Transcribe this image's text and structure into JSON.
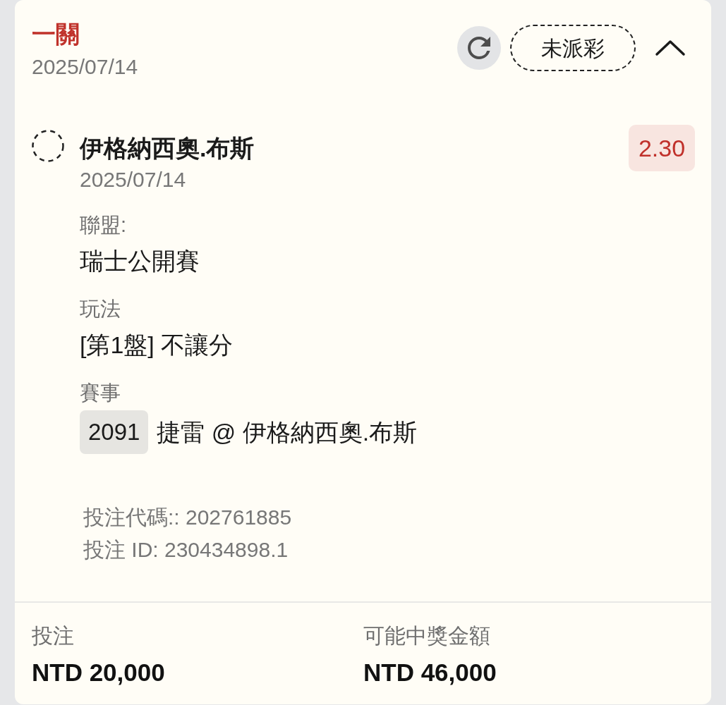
{
  "header": {
    "title": "一關",
    "date": "2025/07/14",
    "status": "未派彩",
    "expanded": true
  },
  "selection": {
    "name": "伊格納西奧.布斯",
    "date": "2025/07/14",
    "odds": "2.30"
  },
  "details": [
    {
      "kind": "text",
      "label": "聯盟:",
      "value": "瑞士公開賽"
    },
    {
      "kind": "text",
      "label": "玩法",
      "value": "[第1盤] 不讓分"
    },
    {
      "kind": "match",
      "label": "賽事",
      "code": "2091",
      "value": "捷雷 @ 伊格納西奧.布斯"
    }
  ],
  "references": [
    "投注代碼:: 202761885",
    "投注 ID: 230434898.1"
  ],
  "summary": [
    {
      "label": "投注",
      "value": "NTD 20,000"
    },
    {
      "label": "可能中獎金額",
      "value": "NTD 46,000"
    }
  ]
}
